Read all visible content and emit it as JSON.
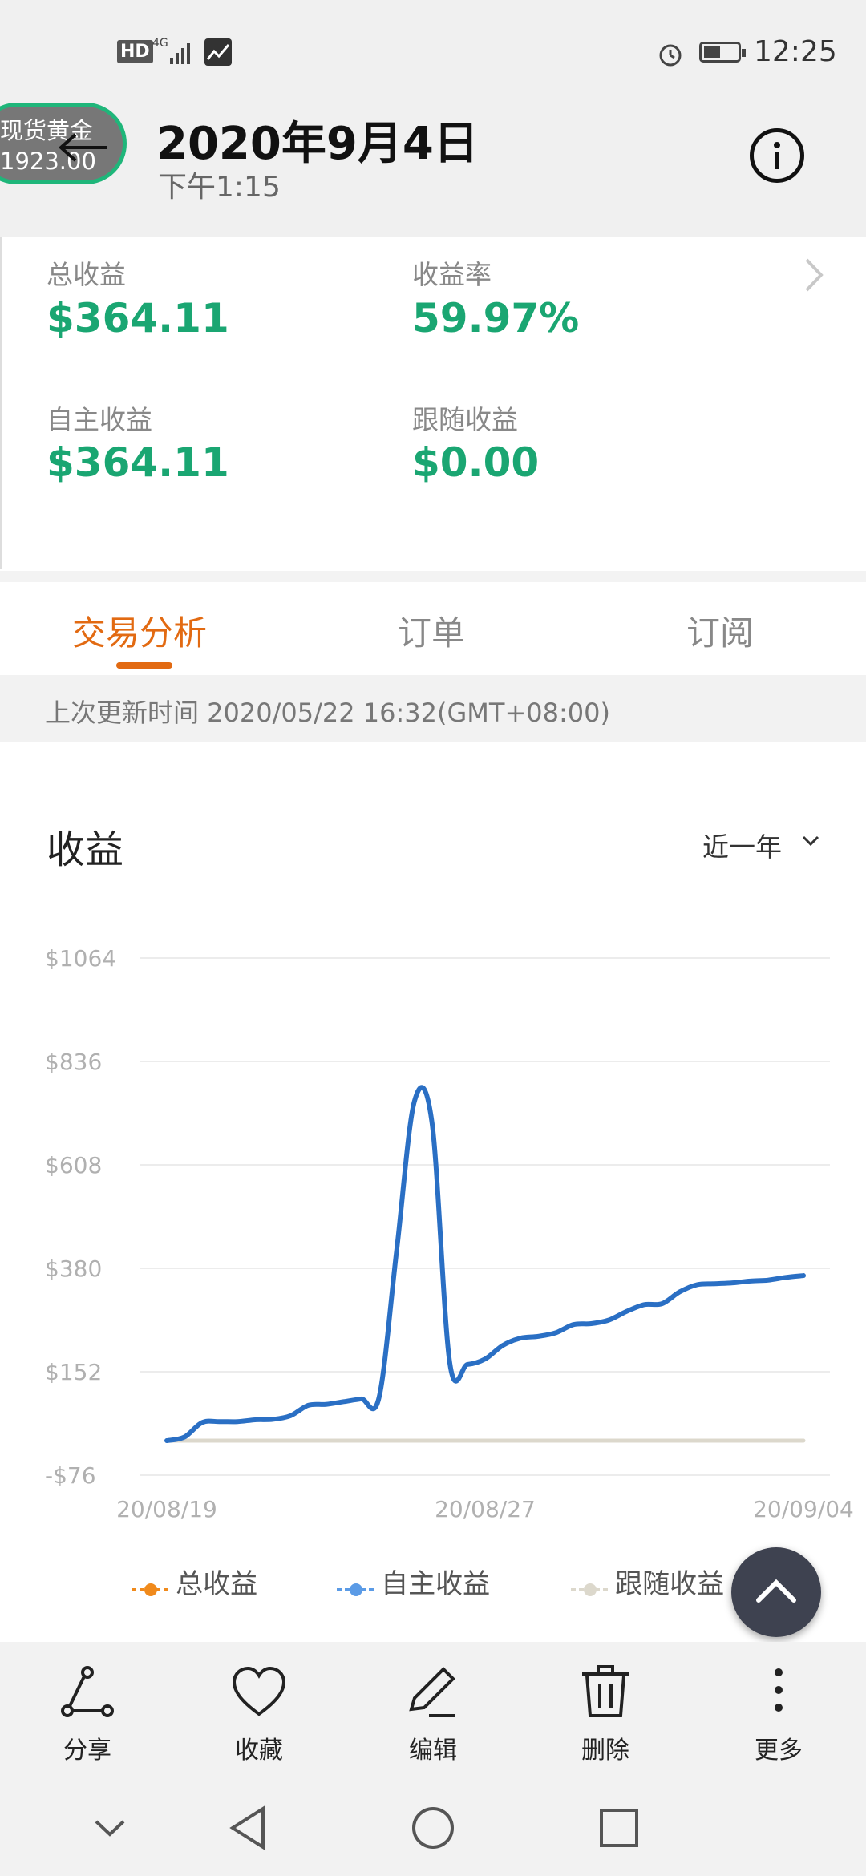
{
  "status_bar": {
    "hd": "HD",
    "network": "4G",
    "time": "12:25"
  },
  "header": {
    "gold_name": "现货黄金",
    "gold_price": "1923.00",
    "date": "2020年9月4日",
    "time": "下午1:15"
  },
  "summary": {
    "total_profit_label": "总收益",
    "total_profit_value": "$364.11",
    "yield_label": "收益率",
    "yield_value": "59.97%",
    "self_profit_label": "自主收益",
    "self_profit_value": "$364.11",
    "follow_profit_label": "跟随收益",
    "follow_profit_value": "$0.00"
  },
  "tabs": [
    {
      "label": "交易分析",
      "active": true
    },
    {
      "label": "订单",
      "active": false
    },
    {
      "label": "订阅",
      "active": false
    }
  ],
  "update_text": "上次更新时间 2020/05/22 16:32(GMT+08:00)",
  "chart_section": {
    "title": "收益",
    "range": "近一年"
  },
  "chart_data": {
    "type": "line",
    "ylim": [
      -76,
      1064
    ],
    "yticks": [
      "$1064",
      "$836",
      "$608",
      "$380",
      "$152",
      "-$76"
    ],
    "xticks": [
      "20/08/19",
      "20/08/27",
      "20/09/04"
    ],
    "x": [
      0,
      1,
      2,
      3,
      4,
      5,
      6,
      7,
      8,
      9,
      10,
      11,
      12,
      13,
      14,
      15,
      16,
      17,
      18,
      19,
      20,
      21,
      22,
      23,
      24,
      25,
      26,
      27,
      28,
      29,
      30,
      31,
      32,
      33,
      34,
      35,
      36
    ],
    "series": [
      {
        "name": "总收益",
        "color": "#f08a1c",
        "values": []
      },
      {
        "name": "自主收益",
        "color": "#2a6fc4",
        "values": [
          0,
          8,
          40,
          42,
          42,
          46,
          47,
          55,
          78,
          80,
          86,
          92,
          95,
          420,
          748,
          700,
          172,
          168,
          180,
          210,
          226,
          230,
          238,
          256,
          258,
          266,
          285,
          300,
          302,
          328,
          344,
          346,
          348,
          352,
          354,
          360,
          364
        ]
      },
      {
        "name": "跟随收益",
        "color": "#dcd8cc",
        "values": [
          0,
          0,
          0,
          0,
          0,
          0,
          0,
          0,
          0,
          0,
          0,
          0,
          0,
          0,
          0,
          0,
          0,
          0,
          0,
          0,
          0,
          0,
          0,
          0,
          0,
          0,
          0,
          0,
          0,
          0,
          0,
          0,
          0,
          0,
          0,
          0,
          0
        ]
      }
    ],
    "grid": true,
    "legend_position": "bottom"
  },
  "legend": [
    {
      "label": "总收益",
      "color": "#f08a1c"
    },
    {
      "label": "自主收益",
      "color": "#5b9be6"
    },
    {
      "label": "跟随收益",
      "color": "#dcd8cc"
    }
  ],
  "toolbar": [
    {
      "label": "分享",
      "icon": "share-icon"
    },
    {
      "label": "收藏",
      "icon": "heart-icon"
    },
    {
      "label": "编辑",
      "icon": "pencil-icon"
    },
    {
      "label": "删除",
      "icon": "trash-icon"
    },
    {
      "label": "更多",
      "icon": "more-icon"
    }
  ]
}
